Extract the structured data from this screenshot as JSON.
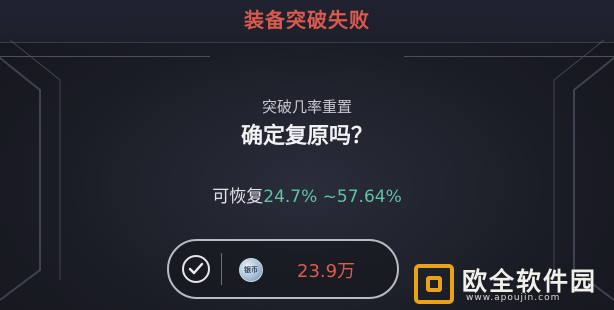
{
  "dialog": {
    "title": "装备突破失败",
    "subtitle": "突破几率重置",
    "question": "确定复原吗？",
    "restore_label": "可恢复",
    "restore_range": "24.7% ~57.64%"
  },
  "confirm_button": {
    "icon": "check-icon",
    "currency_icon": "silver-coin-icon",
    "currency_icon_text": "银币",
    "cost": "23.9万"
  },
  "watermark": {
    "text": "欧全软件园",
    "url": "www.apoujin.com"
  },
  "colors": {
    "title": "#d95a4e",
    "restore_value": "#5fc3a7",
    "cost": "#e05a4f",
    "watermark_logo": "#e9a21a"
  }
}
